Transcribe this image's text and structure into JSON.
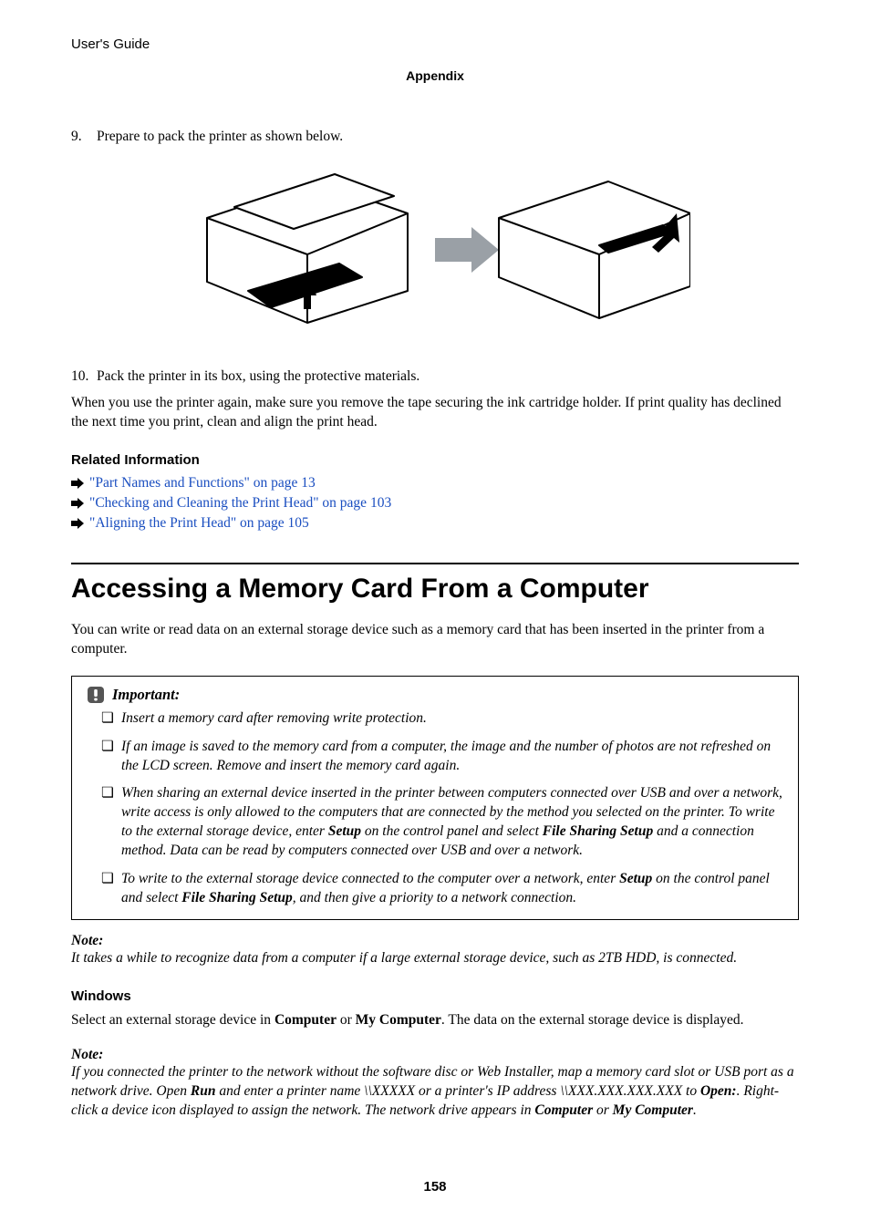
{
  "header": {
    "title": "User's Guide"
  },
  "breadcrumb": "Appendix",
  "step9": {
    "num": "9.",
    "text": "Prepare to pack the printer as shown below."
  },
  "step10": {
    "num": "10.",
    "text": "Pack the printer in its box, using the protective materials."
  },
  "afterSteps": "When you use the printer again, make sure you remove the tape securing the ink cartridge holder. If print quality has declined the next time you print, clean and align the print head.",
  "relatedHead": "Related Information",
  "links": [
    "\"Part Names and Functions\" on page 13",
    "\"Checking and Cleaning the Print Head\" on page 103",
    "\"Aligning the Print Head\" on page 105"
  ],
  "h1": "Accessing a Memory Card From a Computer",
  "intro": "You can write or read data on an external storage device such as a memory card that has been inserted in the printer from a computer.",
  "importantLabel": "Important:",
  "important": {
    "item1": "Insert a memory card after removing write protection.",
    "item2": "If an image is saved to the memory card from a computer, the image and the number of photos are not refreshed on the LCD screen. Remove and insert the memory card again.",
    "item3": {
      "a": "When sharing an external device inserted in the printer between computers connected over USB and over a network, write access is only allowed to the computers that are connected by the method you selected on the printer. To write to the external storage device, enter ",
      "b": "Setup",
      "c": " on the control panel and select ",
      "d": "File Sharing Setup",
      "e": " and a connection method. Data can be read by computers connected over USB and over a network."
    },
    "item4": {
      "a": "To write to the external storage device connected to the computer over a network, enter ",
      "b": "Setup",
      "c": " on the control panel and select ",
      "d": "File Sharing Setup",
      "e": ", and then give a priority to a network connection."
    }
  },
  "note1Label": "Note:",
  "note1": "It takes a while to recognize data from a computer if a large external storage device, such as 2TB HDD, is connected.",
  "windowsHead": "Windows",
  "windowsPara": {
    "a": "Select an external storage device in ",
    "b": "Computer",
    "c": " or ",
    "d": "My Computer",
    "e": ". The data on the external storage device is displayed."
  },
  "note2Label": "Note:",
  "note2": {
    "a": "If you connected the printer to the network without the software disc or Web Installer, map a memory card slot or USB port as a network drive. Open ",
    "b": "Run",
    "c": " and enter a printer name \\\\XXXXX or a printer's IP address \\\\XXX.XXX.XXX.XXX to ",
    "d": "Open:",
    "e": ". Right-click a device icon displayed to assign the network. The network drive appears in ",
    "f": "Computer",
    "g": " or ",
    "h": "My Computer",
    "i": "."
  },
  "pageNumber": "158"
}
